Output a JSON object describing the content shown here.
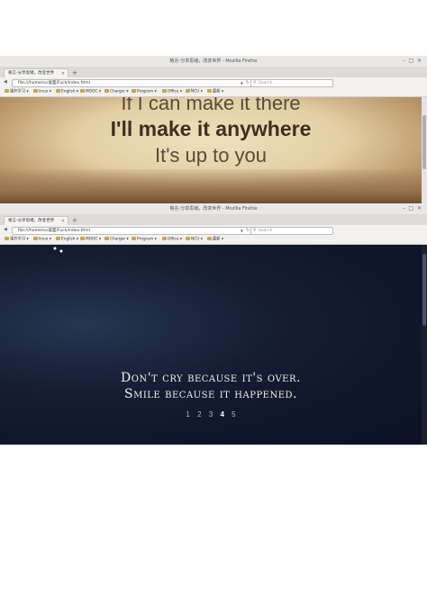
{
  "windows": [
    {
      "title": "格言-分享思绪，改变世界 - Mozilla Firefox",
      "tab_label": "格言-分享思绪，改变世界",
      "url": "file:///home/sc/桌面/Fuck/index.html",
      "search_placeholder": "Search",
      "bookmarks": [
        "课外学习",
        "linux",
        "English",
        "MOOC",
        "Charger",
        "Program",
        "Office",
        "NCU",
        "最新"
      ],
      "quote_lines": [
        "If I can make it there",
        "I'll make it anywhere",
        "It's up to you"
      ]
    },
    {
      "title": "格言-分享思绪，改变世界 - Mozilla Firefox",
      "tab_label": "格言-分享思绪，改变世界",
      "url": "file:///home/sc/桌面/Fuck/index.html",
      "search_placeholder": "Search",
      "bookmarks": [
        "课外学习",
        "linux",
        "English",
        "MOOC",
        "Charger",
        "Program",
        "Office",
        "NCU",
        "最新"
      ],
      "quote_lines": [
        "Don't cry because it's over.",
        "Smile because it happened."
      ],
      "pager": [
        "1",
        "2",
        "3",
        "4",
        "5"
      ],
      "pager_active": "4"
    }
  ],
  "colors": {
    "chrome": "#f2f1f0",
    "night_bg": "#0b1025",
    "sepia_bg": "#e3cfa3"
  }
}
